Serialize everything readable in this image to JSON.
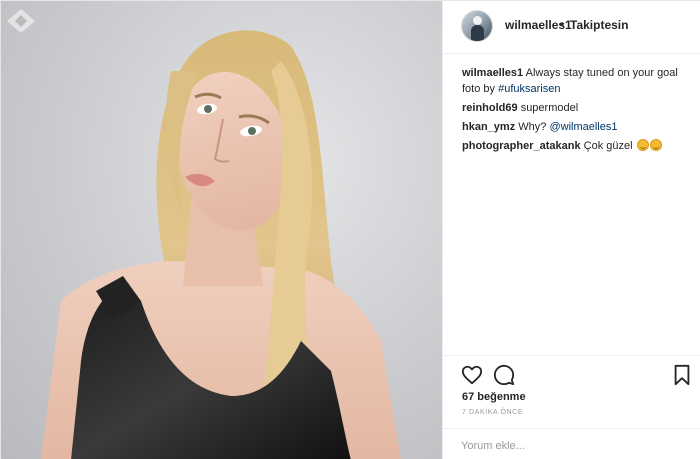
{
  "post": {
    "username": "wilmaelles1",
    "separator": "•",
    "follow_status": "Takiptesin"
  },
  "comments": [
    {
      "user": "wilmaelles1",
      "text": "Always stay tuned on your goal foto by ",
      "link": "#ufuksarisen"
    },
    {
      "user": "reinhold69",
      "text": "supermodel"
    },
    {
      "user": "hkan_ymz",
      "text": "Why? ",
      "link": "@wilmaelles1"
    },
    {
      "user": "photographer_atakank",
      "text": "Çok güzel"
    }
  ],
  "engagement": {
    "likes": "67 beğenme",
    "timestamp": "7 DAKİKA ÖNCE"
  },
  "comment_box": {
    "placeholder": "Yorum ekle..."
  },
  "icons": {
    "like": "heart-icon",
    "comment": "comment-bubble-icon",
    "save": "bookmark-icon"
  }
}
